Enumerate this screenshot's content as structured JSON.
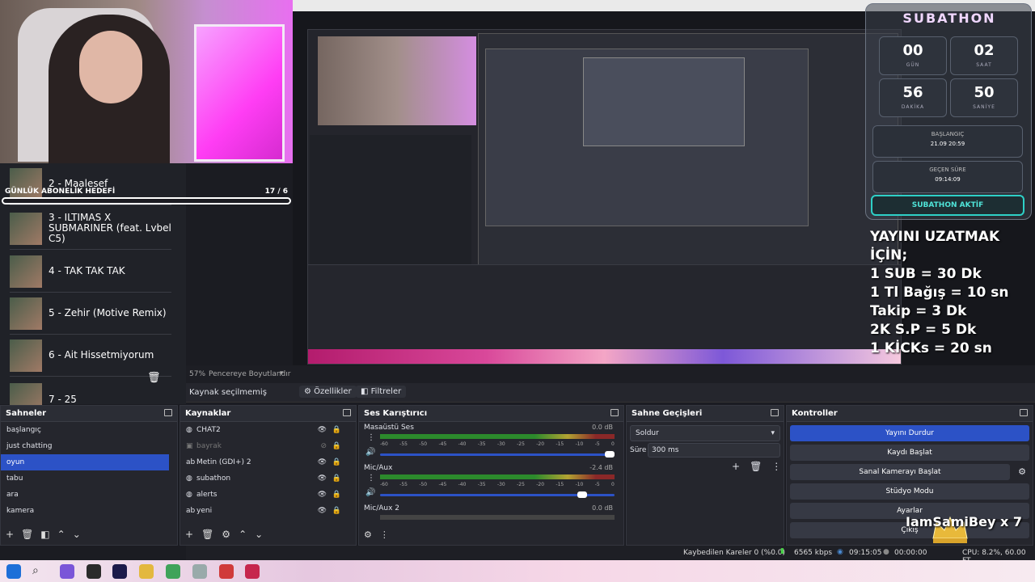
{
  "music": {
    "goal_label": "GÜNLÜK ABONELİK HEDEFİ",
    "goal_count": "17  / 6",
    "songs": [
      {
        "title": "2 - Maalesef"
      },
      {
        "title": "3 - ILTIMAS X SUBMARINER (feat. Lvbel C5)"
      },
      {
        "title": "4 - TAK TAK TAK"
      },
      {
        "title": "5 - Zehir (Motive Remix)"
      },
      {
        "title": "6 - Ait Hissetmiyorum"
      },
      {
        "title": "7 - 25"
      }
    ]
  },
  "subathon": {
    "title": "SUBATHON",
    "days": "00",
    "days_label": "GÜN",
    "hours": "02",
    "hours_label": "SAAT",
    "minutes": "56",
    "minutes_label": "DAKİKA",
    "seconds": "50",
    "seconds_label": "SANİYE",
    "start_label": "BAŞLANGIÇ",
    "start_value": "21.09 20:59",
    "elapsed_label": "GEÇEN SÜRE",
    "elapsed_value": "09:14:09",
    "status_button": "SUBATHON AKTİF"
  },
  "rules": [
    "YAYINI UZATMAK İÇİN;",
    "1 SUB = 30 Dk",
    "1 Tl Bağış = 10 sn",
    "Takip = 3 Dk",
    "2K S.P = 5 Dk",
    "1 KİCKs = 20 sn"
  ],
  "preview": {
    "zoom": "57%",
    "zoom_mode": "Pencereye Boyutlandır"
  },
  "source_bar": {
    "no_source": "Kaynak seçilmemiş",
    "properties": "Özellikler",
    "filters": "Filtreler"
  },
  "scenes": {
    "title": "Sahneler",
    "items": [
      "başlangıç",
      "just chatting",
      "oyun",
      "tabu",
      "ara",
      "kamera"
    ],
    "selected": 2
  },
  "sources": {
    "title": "Kaynaklar",
    "items": [
      {
        "name": "CHAT2",
        "visible": true
      },
      {
        "name": "bayrak",
        "visible": false
      },
      {
        "name": "Metin (GDI+) 2",
        "visible": true
      },
      {
        "name": "subathon",
        "visible": true
      },
      {
        "name": "alerts",
        "visible": true
      },
      {
        "name": "yeni",
        "visible": true
      }
    ]
  },
  "mixer": {
    "title": "Ses Karıştırıcı",
    "channels": [
      {
        "name": "Masaüstü Ses",
        "db": "0.0 dB",
        "level": 0.28,
        "volume": 1.0
      },
      {
        "name": "Mic/Aux",
        "db": "-2.4 dB",
        "level": 0.38,
        "volume": 0.86
      },
      {
        "name": "Mic/Aux 2",
        "db": "0.0 dB",
        "level": 0.0,
        "volume": 1.0
      }
    ],
    "ticks": [
      "-60",
      "-55",
      "-50",
      "-45",
      "-40",
      "-35",
      "-30",
      "-25",
      "-20",
      "-15",
      "-10",
      "-5",
      "0"
    ]
  },
  "transitions": {
    "title": "Sahne Geçişleri",
    "selected": "Soldur",
    "duration_label": "Süre",
    "duration": "300 ms"
  },
  "controls": {
    "title": "Kontroller",
    "buttons": [
      "Yayını Durdur",
      "Kaydı Başlat",
      "Sanal Kamerayı Başlat",
      "Stüdyo Modu",
      "Ayarlar",
      "Çıkış"
    ]
  },
  "status": {
    "dropped": "Kaybedilen Kareler 0 (%0.0)",
    "bitrate": "6565 kbps",
    "live_time": "09:15:05",
    "rec_time": "00:00:00",
    "cpu": "CPU: 8.2%, 60.00 FT"
  },
  "watermark": "IamSamiBey x 7",
  "colors": {
    "accent": "#2c52c6",
    "teal": "#2ed0c7",
    "panel": "#25262d"
  }
}
